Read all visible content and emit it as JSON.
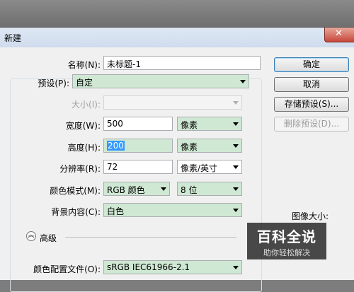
{
  "window": {
    "title": "新建"
  },
  "fields": {
    "name": {
      "label": "名称(N):",
      "value": "未标题-1"
    },
    "preset": {
      "label": "预设(P):",
      "value": "自定"
    },
    "size": {
      "label": "大小(I):",
      "value": ""
    },
    "width": {
      "label": "宽度(W):",
      "value": "500",
      "unit": "像素"
    },
    "height": {
      "label": "高度(H):",
      "value": "200",
      "unit": "像素"
    },
    "resolution": {
      "label": "分辨率(R):",
      "value": "72",
      "unit": "像素/英寸"
    },
    "color_mode": {
      "label": "颜色模式(M):",
      "mode": "RGB 颜色",
      "depth": "8 位"
    },
    "background": {
      "label": "背景内容(C):",
      "value": "白色"
    },
    "advanced": {
      "label": "高级",
      "icon": "chevron-up-icon"
    },
    "color_profile": {
      "label": "颜色配置文件(O):",
      "value": "sRGB IEC61966-2.1"
    }
  },
  "buttons": {
    "ok": "确定",
    "cancel": "取消",
    "save_preset": "存储预设(S)...",
    "delete_preset": "删除预设(D)..."
  },
  "image_size_label": "图像大小:",
  "watermark": {
    "line1": "百科全说",
    "line2": "助你轻松解决"
  }
}
